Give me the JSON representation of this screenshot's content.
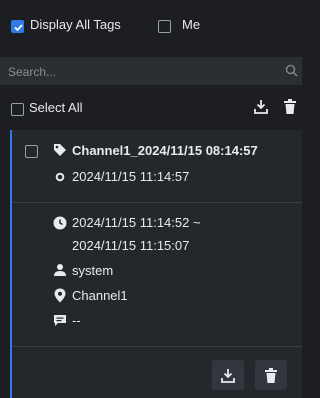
{
  "filter": {
    "display_all_tags_label": "Display All Tags",
    "display_all_tags_checked": true,
    "me_label": "Me",
    "me_checked": false
  },
  "search": {
    "placeholder": "Search..."
  },
  "list_header": {
    "select_all_label": "Select All"
  },
  "card": {
    "title": "Channel1_2024/11/15 08:14:57",
    "tag_time": "2024/11/15 11:14:57",
    "time_range_start": "2024/11/15 11:14:52 ~",
    "time_range_end": "2024/11/15 11:15:07",
    "user": "system",
    "channel": "Channel1",
    "note": "--"
  },
  "colors": {
    "accent": "#2f7be6",
    "background": "#1c1e22",
    "card": "#24272c"
  },
  "icons": [
    "checkbox",
    "search-icon",
    "download-icon",
    "trash-icon",
    "tag-icon",
    "dot-icon",
    "clock-icon",
    "user-icon",
    "location-pin-icon",
    "comment-icon"
  ]
}
